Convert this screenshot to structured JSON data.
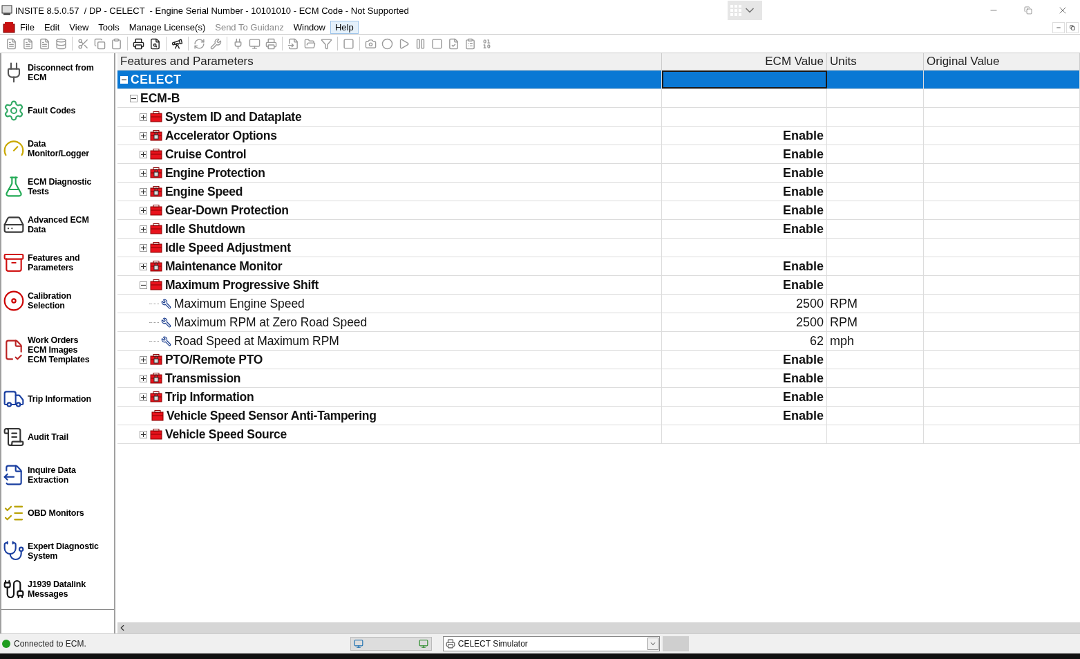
{
  "window": {
    "title": "INSITE 8.5.0.57  / DP - CELECT  - Engine Serial Number - 10101010 - ECM Code - Not Supported"
  },
  "menu": [
    {
      "label": "File",
      "disabled": false,
      "highlighted": false
    },
    {
      "label": "Edit",
      "disabled": false,
      "highlighted": false
    },
    {
      "label": "View",
      "disabled": false,
      "highlighted": false
    },
    {
      "label": "Tools",
      "disabled": false,
      "highlighted": false
    },
    {
      "label": "Manage License(s)",
      "disabled": false,
      "highlighted": false
    },
    {
      "label": "Send To Guidanz",
      "disabled": true,
      "highlighted": false
    },
    {
      "label": "Window",
      "disabled": false,
      "highlighted": false
    },
    {
      "label": "Help",
      "disabled": false,
      "highlighted": true
    }
  ],
  "sidebar": {
    "items": [
      {
        "label": "Disconnect from\nECM"
      },
      {
        "label": "Fault Codes"
      },
      {
        "label": "Data\nMonitor/Logger"
      },
      {
        "label": "ECM Diagnostic\nTests"
      },
      {
        "label": "Advanced ECM\nData"
      },
      {
        "label": "Features and\nParameters"
      },
      {
        "label": "Calibration\nSelection"
      },
      {
        "label": "Work Orders\nECM Images\nECM Templates"
      },
      {
        "label": "Trip Information"
      },
      {
        "label": "Audit Trail"
      },
      {
        "label": "Inquire Data\nExtraction"
      },
      {
        "label": "OBD Monitors"
      },
      {
        "label": "Expert Diagnostic\nSystem"
      },
      {
        "label": "J1939 Datalink\nMessages"
      }
    ]
  },
  "table": {
    "columns": [
      "Features and Parameters",
      "ECM Value",
      "Units",
      "Original Value"
    ],
    "tree": [
      {
        "kind": "root",
        "label": "CELECT",
        "selected": true,
        "expanded": true,
        "children": [
          {
            "kind": "ecm",
            "label": "ECM-B",
            "selected": false,
            "expanded": true,
            "children": [
              {
                "kind": "group",
                "label": "System ID and Dataplate",
                "locked": false,
                "selected": false,
                "expanded": false
              },
              {
                "kind": "group",
                "label": "Accelerator Options",
                "locked": true,
                "selected": false,
                "expanded": false,
                "ecm_value": "Enable"
              },
              {
                "kind": "group",
                "label": "Cruise Control",
                "locked": false,
                "selected": false,
                "expanded": false,
                "ecm_value": "Enable"
              },
              {
                "kind": "group",
                "label": "Engine Protection",
                "locked": true,
                "selected": false,
                "expanded": false,
                "ecm_value": "Enable"
              },
              {
                "kind": "group",
                "label": "Engine Speed",
                "locked": true,
                "selected": false,
                "expanded": false,
                "ecm_value": "Enable"
              },
              {
                "kind": "group",
                "label": "Gear-Down Protection",
                "locked": false,
                "selected": false,
                "expanded": false,
                "ecm_value": "Enable"
              },
              {
                "kind": "group",
                "label": "Idle Shutdown",
                "locked": false,
                "selected": false,
                "expanded": false,
                "ecm_value": "Enable"
              },
              {
                "kind": "group",
                "label": "Idle Speed Adjustment",
                "locked": false,
                "selected": false,
                "expanded": false
              },
              {
                "kind": "group",
                "label": "Maintenance Monitor",
                "locked": true,
                "selected": false,
                "expanded": false,
                "ecm_value": "Enable"
              },
              {
                "kind": "group",
                "label": "Maximum Progressive Shift",
                "locked": false,
                "selected": false,
                "expanded": true,
                "ecm_value": "Enable",
                "children": [
                  {
                    "kind": "param",
                    "label": "Maximum Engine Speed",
                    "selected": false,
                    "ecm_value": "2500",
                    "units": "RPM"
                  },
                  {
                    "kind": "param",
                    "label": "Maximum RPM at Zero Road Speed",
                    "selected": false,
                    "ecm_value": "2500",
                    "units": "RPM"
                  },
                  {
                    "kind": "param",
                    "label": "Road Speed at Maximum RPM",
                    "selected": false,
                    "ecm_value": "62",
                    "units": "mph"
                  }
                ]
              },
              {
                "kind": "group",
                "label": "PTO/Remote PTO",
                "locked": true,
                "selected": false,
                "expanded": false,
                "ecm_value": "Enable"
              },
              {
                "kind": "group",
                "label": "Transmission",
                "locked": true,
                "selected": false,
                "expanded": false,
                "ecm_value": "Enable"
              },
              {
                "kind": "group",
                "label": "Trip Information",
                "locked": true,
                "selected": false,
                "expanded": false,
                "ecm_value": "Enable"
              },
              {
                "kind": "group",
                "label": "Vehicle Speed Sensor Anti-Tampering",
                "locked": false,
                "selected": false,
                "ecm_value": "Enable"
              },
              {
                "kind": "group",
                "label": "Vehicle Speed Source",
                "locked": false,
                "selected": false,
                "expanded": false
              }
            ]
          }
        ]
      }
    ]
  },
  "status_bar": {
    "connection": {
      "text": "Connected to ECM.",
      "color": "#1f9d1f"
    },
    "device": {
      "value": "CELECT Simulator"
    }
  }
}
